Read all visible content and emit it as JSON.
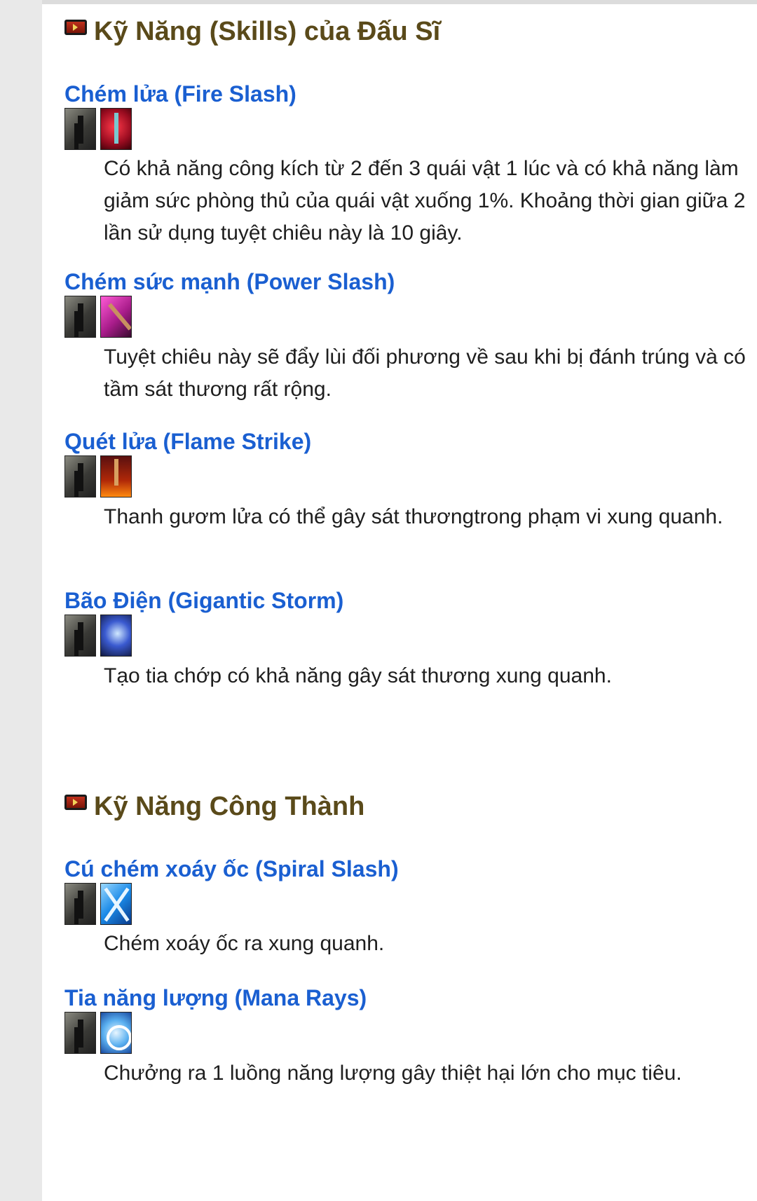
{
  "sections": [
    {
      "title": "Kỹ Năng (Skills) của Đấu Sĩ",
      "skills": [
        {
          "name": "Chém lửa (Fire Slash)",
          "icons": [
            "fire-slash-grey-icon",
            "fire-slash-color-icon"
          ],
          "description": "Có khả năng công kích từ 2 đến 3 quái vật 1 lúc và có khả năng làm giảm sức phòng thủ của quái vật xuống 1%. Khoảng thời gian giữa 2 lần sử dụng tuyệt chiêu này là 10 giây."
        },
        {
          "name": "Chém sức mạnh (Power Slash)",
          "icons": [
            "power-slash-grey-icon",
            "power-slash-color-icon"
          ],
          "description": "Tuyệt chiêu này sẽ đẩy lùi đối phương về sau khi bị đánh trúng và có tầm sát thương rất rộng."
        },
        {
          "name": "Quét lửa (Flame Strike)",
          "icons": [
            "flame-strike-grey-icon",
            "flame-strike-color-icon"
          ],
          "description": "Thanh gươm lửa có thể gây sát thươngtrong phạm vi xung quanh."
        },
        {
          "name": "Bão Điện (Gigantic Storm)",
          "icons": [
            "gigantic-storm-grey-icon",
            "gigantic-storm-color-icon"
          ],
          "description": "Tạo tia chớp có khả năng gây sát thương xung quanh."
        }
      ]
    },
    {
      "title": "Kỹ Năng Công Thành",
      "skills": [
        {
          "name": "Cú chém xoáy ốc (Spiral Slash)",
          "icons": [
            "spiral-slash-grey-icon",
            "spiral-slash-color-icon"
          ],
          "description": "Chém xoáy ốc ra xung quanh."
        },
        {
          "name": "Tia năng lượng (Mana Rays)",
          "icons": [
            "mana-rays-grey-icon",
            "mana-rays-color-icon"
          ],
          "description": "Chưởng ra 1 luồng năng lượng gây thiệt hại lớn cho mục tiêu."
        }
      ]
    }
  ]
}
